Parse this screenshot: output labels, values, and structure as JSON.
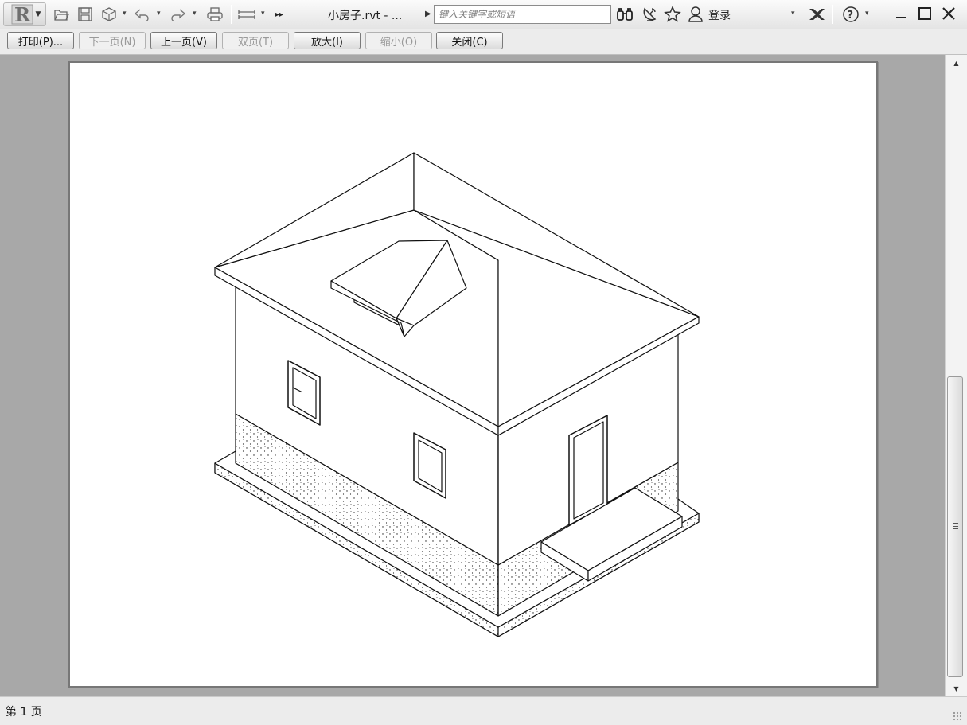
{
  "titlebar": {
    "document_title": "小房子.rvt - ...",
    "search_placeholder": "键入关键字或短语",
    "login_label": "登录"
  },
  "toolbar": {
    "buttons": [
      {
        "label": "打印(P)...",
        "enabled": true
      },
      {
        "label": "下一页(N)",
        "enabled": false
      },
      {
        "label": "上一页(V)",
        "enabled": true
      },
      {
        "label": "双页(T)",
        "enabled": false
      },
      {
        "label": "放大(I)",
        "enabled": true
      },
      {
        "label": "缩小(O)",
        "enabled": false
      },
      {
        "label": "关闭(C)",
        "enabled": true
      }
    ]
  },
  "status": {
    "page_indicator": "第 1 页"
  },
  "icons": [
    "revit-logo-icon",
    "open-icon",
    "save-icon",
    "sync-icon",
    "undo-icon",
    "redo-icon",
    "print-icon",
    "measure-icon",
    "expand-icon",
    "binoculars-icon",
    "satellite-icon",
    "star-icon",
    "user-icon",
    "exchange-icon",
    "help-icon",
    "minimize-icon",
    "maximize-icon",
    "close-icon"
  ],
  "colors": {
    "viewport_background": "#a8a8a8",
    "paper": "#ffffff",
    "toolbar": "#ececec"
  }
}
